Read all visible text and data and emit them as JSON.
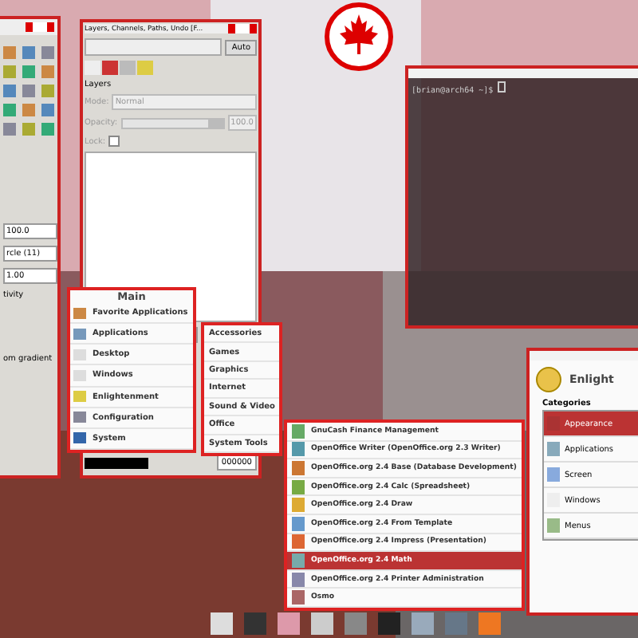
{
  "toolbox": {
    "texts": [
      "100.0",
      "rcle (11)",
      "1.00",
      "tivity",
      "om gradient"
    ]
  },
  "layers_window": {
    "title": "Layers, Channels, Paths, Undo [F...",
    "auto_button": "Auto",
    "heading": "Layers",
    "mode_label": "Mode:",
    "mode_value": "Normal",
    "opacity_label": "Opacity:",
    "opacity_value": "100.0",
    "opacity_slider": {
      "level": 1
    },
    "lock_label": "Lock:",
    "lock_checked": false,
    "color_field": "000000"
  },
  "terminal": {
    "prompt": "[brian@arch64 ~]$"
  },
  "main_menu": {
    "title": "Main",
    "items": [
      {
        "label": "Favorite Applications",
        "selected": false
      },
      {
        "label": "Applications",
        "selected": false
      },
      {
        "label": "Desktop",
        "selected": false
      },
      {
        "label": "Windows",
        "selected": false
      },
      {
        "label": "Enlightenment",
        "selected": false
      },
      {
        "label": "Configuration",
        "selected": false
      },
      {
        "label": "System",
        "selected": false
      }
    ]
  },
  "applications_menu": {
    "items": [
      {
        "label": "Accessories",
        "selected": false
      },
      {
        "label": "Games",
        "selected": false
      },
      {
        "label": "Graphics",
        "selected": false
      },
      {
        "label": "Internet",
        "selected": false
      },
      {
        "label": "Sound & Video",
        "selected": false
      },
      {
        "label": "Office",
        "selected": false
      },
      {
        "label": "System Tools",
        "selected": false
      }
    ]
  },
  "office_menu": {
    "items": [
      {
        "label": "GnuCash Finance Management",
        "selected": false
      },
      {
        "label": "OpenOffice Writer (OpenOffice.org 2.3 Writer)",
        "selected": false
      },
      {
        "label": "OpenOffice.org 2.4 Base (Database Development)",
        "selected": false
      },
      {
        "label": "OpenOffice.org 2.4 Calc (Spreadsheet)",
        "selected": false
      },
      {
        "label": "OpenOffice.org 2.4 Draw",
        "selected": false
      },
      {
        "label": "OpenOffice.org 2.4 From Template",
        "selected": false
      },
      {
        "label": "OpenOffice.org 2.4 Impress (Presentation)",
        "selected": false
      },
      {
        "label": "OpenOffice.org 2.4 Math",
        "selected": true
      },
      {
        "label": "OpenOffice.org 2.4 Printer Administration",
        "selected": false
      },
      {
        "label": "Osmo",
        "selected": false
      }
    ]
  },
  "settings_window": {
    "title": "Enlight",
    "categories_label": "Categories",
    "categories": [
      {
        "label": "Appearance",
        "selected": true
      },
      {
        "label": "Applications",
        "selected": false
      },
      {
        "label": "Screen",
        "selected": false
      },
      {
        "label": "Windows",
        "selected": false
      },
      {
        "label": "Menus",
        "selected": false
      }
    ]
  }
}
